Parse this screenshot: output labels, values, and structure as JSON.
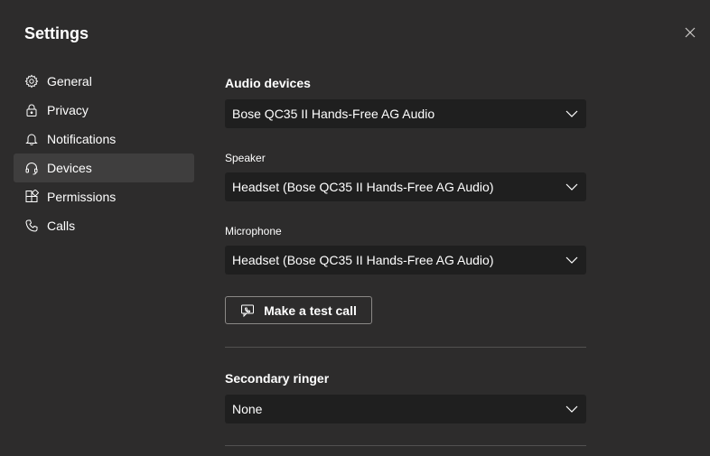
{
  "window": {
    "title": "Settings"
  },
  "sidebar": {
    "items": [
      {
        "label": "General",
        "icon": "gear-icon",
        "active": false
      },
      {
        "label": "Privacy",
        "icon": "lock-icon",
        "active": false
      },
      {
        "label": "Notifications",
        "icon": "bell-icon",
        "active": false
      },
      {
        "label": "Devices",
        "icon": "headset-icon",
        "active": true
      },
      {
        "label": "Permissions",
        "icon": "apps-icon",
        "active": false
      },
      {
        "label": "Calls",
        "icon": "phone-icon",
        "active": false
      }
    ]
  },
  "devices": {
    "audio_heading": "Audio devices",
    "audio_device_value": "Bose QC35 II Hands-Free AG Audio",
    "speaker_label": "Speaker",
    "speaker_value": "Headset (Bose QC35 II Hands-Free AG Audio)",
    "microphone_label": "Microphone",
    "microphone_value": "Headset (Bose QC35 II Hands-Free AG Audio)",
    "test_call_label": "Make a test call",
    "secondary_ringer_heading": "Secondary ringer",
    "secondary_ringer_value": "None"
  },
  "colors": {
    "background": "#2d2c2c",
    "active_nav": "#3f3e3e",
    "select_bg": "#1f1f1f",
    "divider": "#525150",
    "button_border": "#8a8886"
  }
}
